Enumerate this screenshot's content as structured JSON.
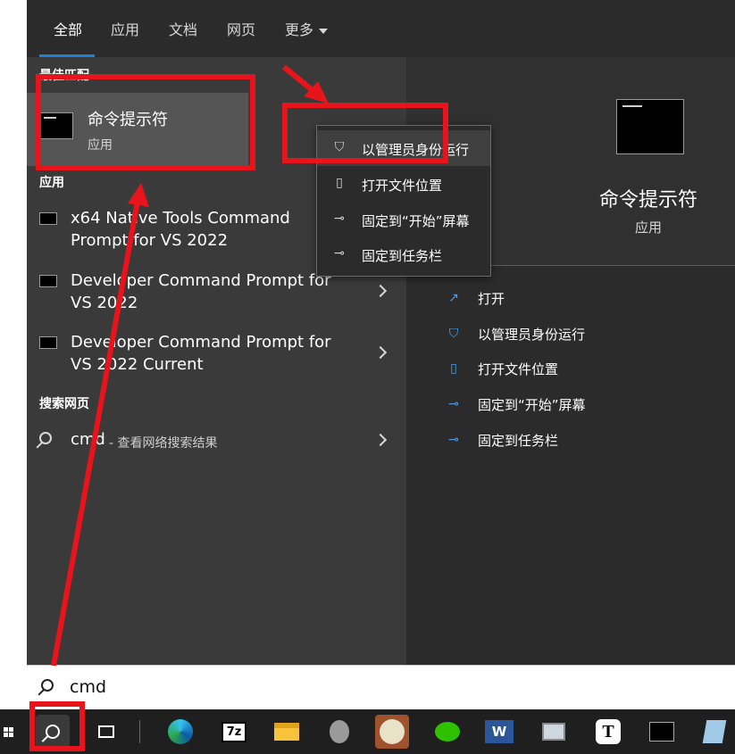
{
  "tabs": {
    "all": "全部",
    "apps": "应用",
    "docs": "文档",
    "web": "网页",
    "more": "更多"
  },
  "left": {
    "best_match_heading": "最佳匹配",
    "best_match": {
      "title": "命令提示符",
      "subtitle": "应用"
    },
    "apps_heading": "应用",
    "apps": [
      {
        "line1": "x64 Native Tools Command",
        "line2": "Prompt for VS 2022"
      },
      {
        "line1": "Developer Command Prompt for",
        "line2": "VS 2022"
      },
      {
        "line1": "Developer Command Prompt for",
        "line2": "VS 2022 Current"
      }
    ],
    "web_heading": "搜索网页",
    "web_result": {
      "query": "cmd",
      "suffix": "- 查看网络搜索结果"
    }
  },
  "context_menu": [
    {
      "label": "以管理员身份运行",
      "icon": "shield-icon"
    },
    {
      "label": "打开文件位置",
      "icon": "folder-icon"
    },
    {
      "label": "固定到“开始”屏幕",
      "icon": "pin-icon"
    },
    {
      "label": "固定到任务栏",
      "icon": "pin-icon"
    }
  ],
  "details": {
    "title": "命令提示符",
    "subtitle": "应用",
    "actions": [
      {
        "label": "打开",
        "icon": "open-icon"
      },
      {
        "label": "以管理员身份运行",
        "icon": "shield-icon"
      },
      {
        "label": "打开文件位置",
        "icon": "folder-icon"
      },
      {
        "label": "固定到“开始”屏幕",
        "icon": "pin-icon"
      },
      {
        "label": "固定到任务栏",
        "icon": "pin-icon"
      }
    ]
  },
  "search": {
    "value": "cmd"
  },
  "taskbar": {
    "items": [
      {
        "name": "search-icon"
      },
      {
        "name": "task-view-icon"
      },
      {
        "name": "edge-icon"
      },
      {
        "name": "7zip-icon",
        "text": "7z"
      },
      {
        "name": "file-explorer-icon"
      },
      {
        "name": "speaker-icon"
      },
      {
        "name": "app-icon"
      },
      {
        "name": "wechat-icon"
      },
      {
        "name": "word-icon",
        "text": "W"
      },
      {
        "name": "computer-icon"
      },
      {
        "name": "typora-icon",
        "text": "T"
      },
      {
        "name": "terminal-icon"
      },
      {
        "name": "notes-icon"
      }
    ]
  },
  "colors": {
    "annotation_red": "#e8141c",
    "accent_blue": "#1e7fd6",
    "panel_dark": "#2b2b2b",
    "panel_mid": "#3a3a3a"
  }
}
